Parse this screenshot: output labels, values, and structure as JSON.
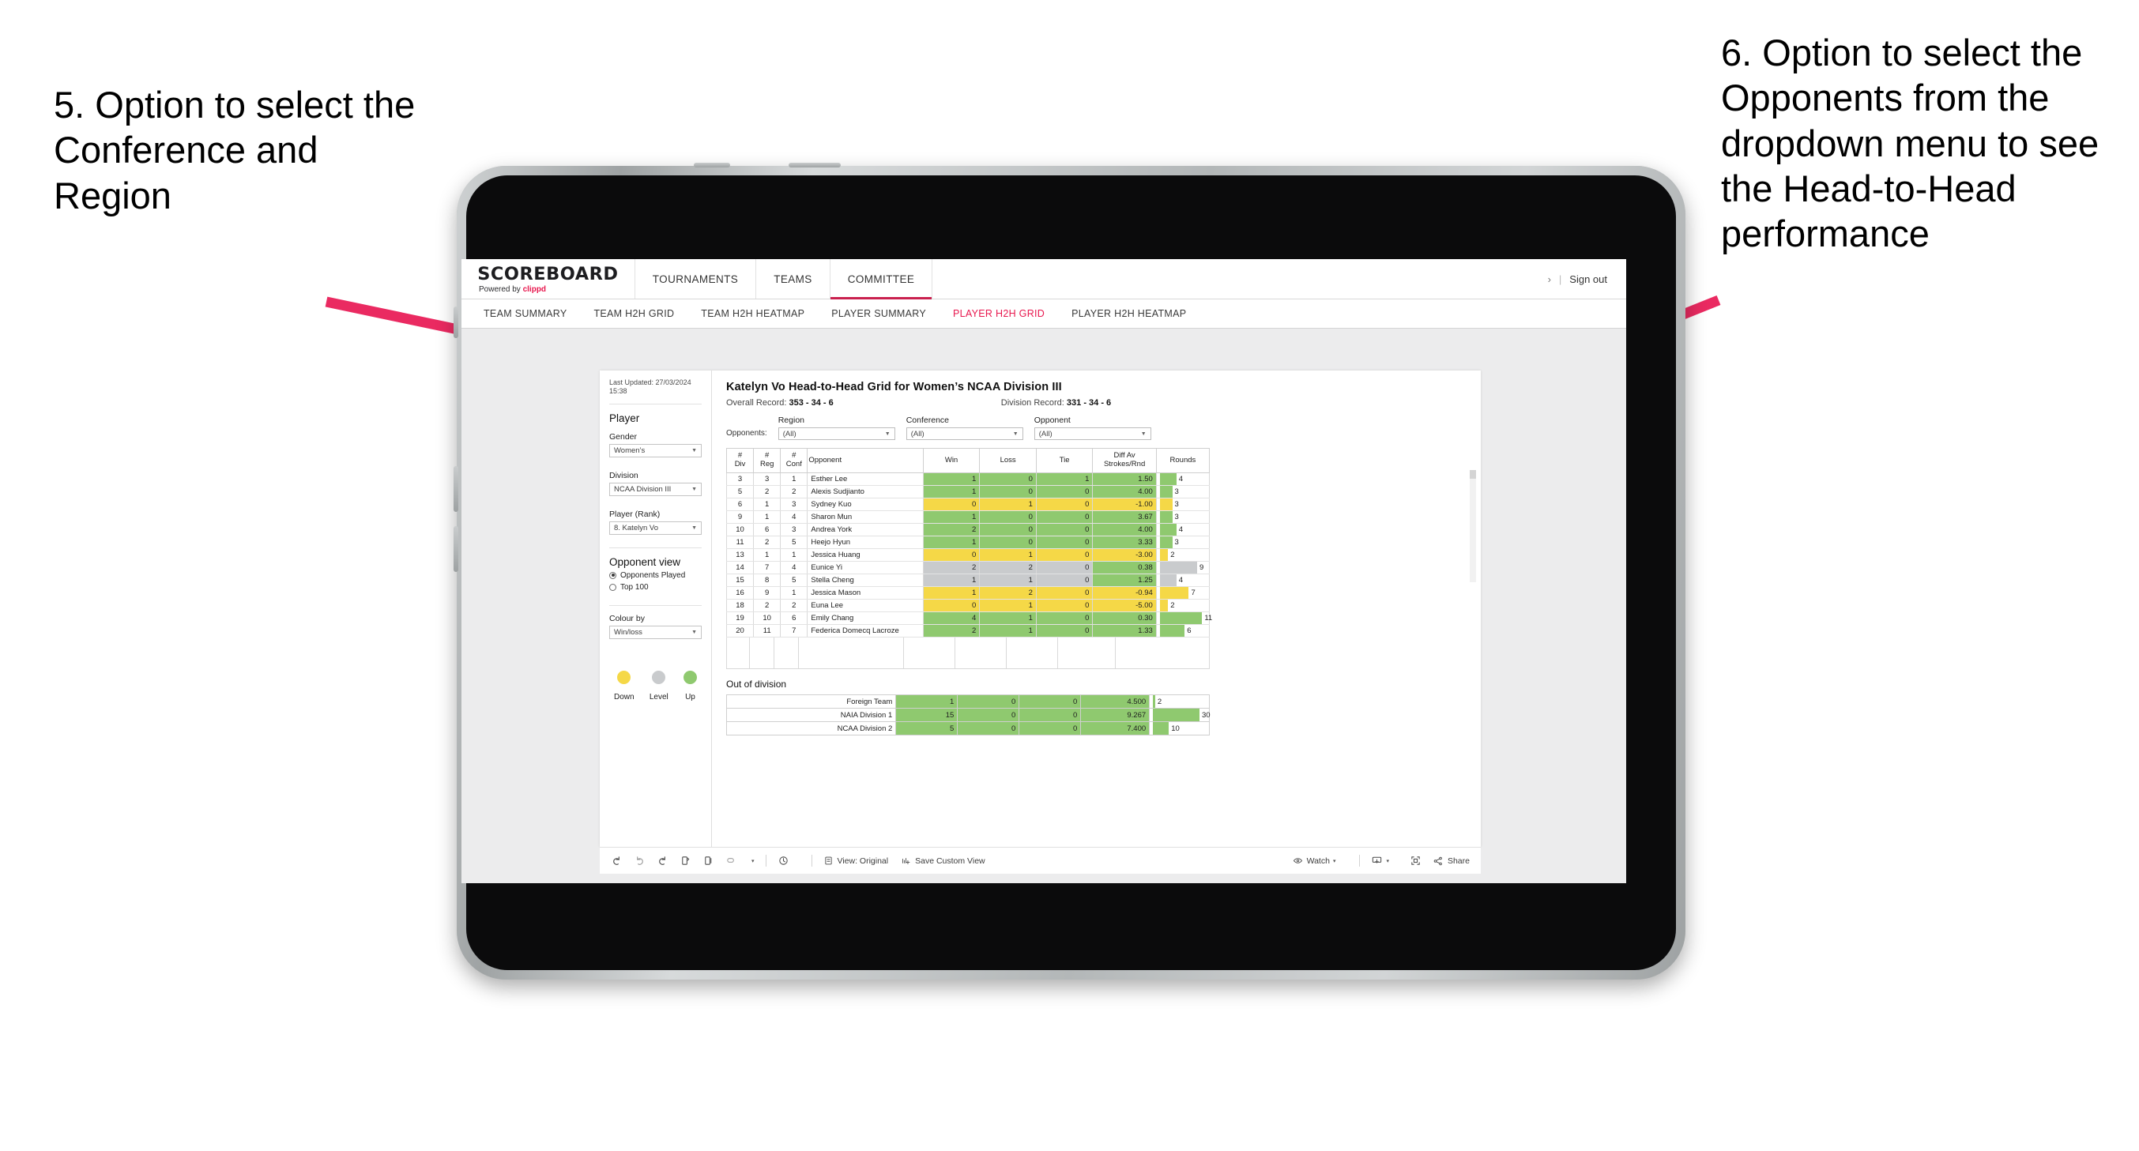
{
  "annotations": {
    "left": "5. Option to select the Conference and Region",
    "right": "6. Option to select the Opponents from the dropdown menu to see the Head-to-Head performance",
    "arrow_color": "#ea2a61"
  },
  "topnav": {
    "brand_name": "SCOREBOARD",
    "brand_sub_prefix": "Powered by ",
    "brand_sub_accent": "clippd",
    "items": [
      {
        "label": "TOURNAMENTS",
        "active": false
      },
      {
        "label": "TEAMS",
        "active": false
      },
      {
        "label": "COMMITTEE",
        "active": true
      }
    ],
    "chevron": "›",
    "separator": "|",
    "signout": "Sign out",
    "accent": "#c9204e"
  },
  "subnav": {
    "items": [
      {
        "label": "TEAM SUMMARY",
        "active": false
      },
      {
        "label": "TEAM H2H GRID",
        "active": false
      },
      {
        "label": "TEAM H2H HEATMAP",
        "active": false
      },
      {
        "label": "PLAYER SUMMARY",
        "active": false
      },
      {
        "label": "PLAYER H2H GRID",
        "active": true
      },
      {
        "label": "PLAYER H2H HEATMAP",
        "active": false
      }
    ],
    "active_color": "#e8174e"
  },
  "sidebar": {
    "last_updated": "Last Updated: 27/03/2024 15:38",
    "player_heading": "Player",
    "gender_label": "Gender",
    "gender_value": "Women’s",
    "division_label": "Division",
    "division_value": "NCAA Division III",
    "player_rank_label": "Player (Rank)",
    "player_rank_value": "8. Katelyn Vo",
    "opponent_view_heading": "Opponent view",
    "opponent_view_options": [
      {
        "label": "Opponents Played",
        "selected": true
      },
      {
        "label": "Top 100",
        "selected": false
      }
    ],
    "colour_by_label": "Colour by",
    "colour_by_value": "Win/loss",
    "legend": [
      {
        "label": "Down",
        "color": "#f5d847"
      },
      {
        "label": "Level",
        "color": "#c9cbcd"
      },
      {
        "label": "Up",
        "color": "#8fc96f"
      }
    ]
  },
  "main": {
    "title": "Katelyn Vo Head-to-Head Grid for Women’s NCAA Division III",
    "overall_record_label": "Overall Record:",
    "overall_record_value": "353 - 34 - 6",
    "division_record_label": "Division Record:",
    "division_record_value": "331 - 34 - 6",
    "opponents_label": "Opponents:",
    "filters": [
      {
        "name": "Region",
        "value": "(All)"
      },
      {
        "name": "Conference",
        "value": "(All)"
      },
      {
        "name": "Opponent",
        "value": "(All)"
      }
    ]
  },
  "table": {
    "headers": [
      "# Div",
      "# Reg",
      "# Conf",
      "Opponent",
      "Win",
      "Loss",
      "Tie",
      "Diff Av Strokes/Rnd",
      "Rounds"
    ],
    "header_lines": [
      [
        "#",
        "Div"
      ],
      [
        "#",
        "Reg"
      ],
      [
        "#",
        "Conf"
      ],
      [
        "Opponent"
      ],
      [
        "Win"
      ],
      [
        "Loss"
      ],
      [
        "Tie"
      ],
      [
        "Diff Av",
        "Strokes/Rnd"
      ],
      [
        "Rounds"
      ]
    ],
    "rows": [
      {
        "div": "3",
        "reg": "3",
        "conf": "1",
        "opponent": "Esther Lee",
        "win": "1",
        "loss": "0",
        "tie": "1",
        "diff": "1.50",
        "rounds": "4",
        "color": "#8fc96f",
        "bar_pct": 36
      },
      {
        "div": "5",
        "reg": "2",
        "conf": "2",
        "opponent": "Alexis Sudjianto",
        "win": "1",
        "loss": "0",
        "tie": "0",
        "diff": "4.00",
        "rounds": "3",
        "color": "#8fc96f",
        "bar_pct": 27
      },
      {
        "div": "6",
        "reg": "1",
        "conf": "3",
        "opponent": "Sydney Kuo",
        "win": "0",
        "loss": "1",
        "tie": "0",
        "diff": "-1.00",
        "rounds": "3",
        "color": "#f5d847",
        "bar_pct": 27
      },
      {
        "div": "9",
        "reg": "1",
        "conf": "4",
        "opponent": "Sharon Mun",
        "win": "1",
        "loss": "0",
        "tie": "0",
        "diff": "3.67",
        "rounds": "3",
        "color": "#8fc96f",
        "bar_pct": 27
      },
      {
        "div": "10",
        "reg": "6",
        "conf": "3",
        "opponent": "Andrea York",
        "win": "2",
        "loss": "0",
        "tie": "0",
        "diff": "4.00",
        "rounds": "4",
        "color": "#8fc96f",
        "bar_pct": 36
      },
      {
        "div": "11",
        "reg": "2",
        "conf": "5",
        "opponent": "Heejo Hyun",
        "win": "1",
        "loss": "0",
        "tie": "0",
        "diff": "3.33",
        "rounds": "3",
        "color": "#8fc96f",
        "bar_pct": 27
      },
      {
        "div": "13",
        "reg": "1",
        "conf": "1",
        "opponent": "Jessica Huang",
        "win": "0",
        "loss": "1",
        "tie": "0",
        "diff": "-3.00",
        "rounds": "2",
        "color": "#f5d847",
        "bar_pct": 18
      },
      {
        "div": "14",
        "reg": "7",
        "conf": "4",
        "opponent": "Eunice Yi",
        "win": "2",
        "loss": "2",
        "tie": "0",
        "diff": "0.38",
        "rounds": "9",
        "color": "#c9cbcd",
        "bar_pct": 81,
        "diff_color": "#8fc96f"
      },
      {
        "div": "15",
        "reg": "8",
        "conf": "5",
        "opponent": "Stella Cheng",
        "win": "1",
        "loss": "1",
        "tie": "0",
        "diff": "1.25",
        "rounds": "4",
        "color": "#c9cbcd",
        "bar_pct": 36,
        "diff_color": "#8fc96f"
      },
      {
        "div": "16",
        "reg": "9",
        "conf": "1",
        "opponent": "Jessica Mason",
        "win": "1",
        "loss": "2",
        "tie": "0",
        "diff": "-0.94",
        "rounds": "7",
        "color": "#f5d847",
        "bar_pct": 63
      },
      {
        "div": "18",
        "reg": "2",
        "conf": "2",
        "opponent": "Euna Lee",
        "win": "0",
        "loss": "1",
        "tie": "0",
        "diff": "-5.00",
        "rounds": "2",
        "color": "#f5d847",
        "bar_pct": 18
      },
      {
        "div": "19",
        "reg": "10",
        "conf": "6",
        "opponent": "Emily Chang",
        "win": "4",
        "loss": "1",
        "tie": "0",
        "diff": "0.30",
        "rounds": "11",
        "color": "#8fc96f",
        "bar_pct": 92
      },
      {
        "div": "20",
        "reg": "11",
        "conf": "7",
        "opponent": "Federica Domecq Lacroze",
        "win": "2",
        "loss": "1",
        "tie": "0",
        "diff": "1.33",
        "rounds": "6",
        "color": "#8fc96f",
        "bar_pct": 54
      }
    ]
  },
  "out_of_division": {
    "title": "Out of division",
    "rows": [
      {
        "name": "Foreign Team",
        "win": "1",
        "loss": "0",
        "tie": "0",
        "diff": "4.500",
        "rounds": "2",
        "color": "#8fc96f",
        "bar_pct": 4
      },
      {
        "name": "NAIA Division 1",
        "win": "15",
        "loss": "0",
        "tie": "0",
        "diff": "9.267",
        "rounds": "30",
        "color": "#8fc96f",
        "bar_pct": 88
      },
      {
        "name": "NCAA Division 2",
        "win": "5",
        "loss": "0",
        "tie": "0",
        "diff": "7.400",
        "rounds": "10",
        "color": "#8fc96f",
        "bar_pct": 30
      }
    ]
  },
  "bottombar": {
    "view_label": "View: Original",
    "save_label": "Save Custom View",
    "watch_label": "Watch",
    "share_label": "Share",
    "caret": "▾"
  }
}
